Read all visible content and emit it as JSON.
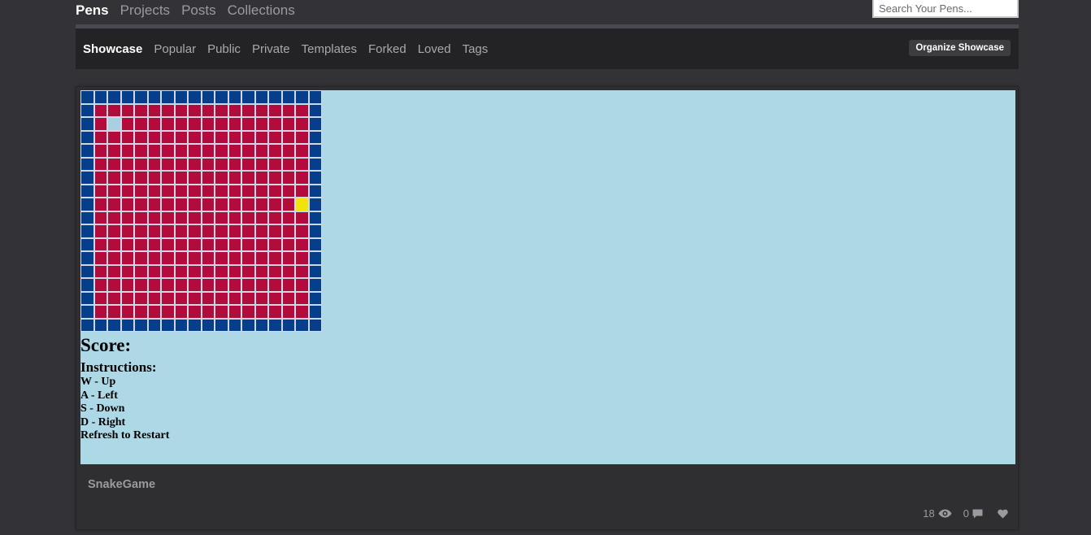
{
  "top_nav": {
    "items": [
      {
        "label": "Pens",
        "active": true
      },
      {
        "label": "Projects",
        "active": false
      },
      {
        "label": "Posts",
        "active": false
      },
      {
        "label": "Collections",
        "active": false
      }
    ]
  },
  "search": {
    "placeholder": "Search Your Pens..."
  },
  "sub_nav": {
    "items": [
      {
        "label": "Showcase",
        "active": true
      },
      {
        "label": "Popular",
        "active": false
      },
      {
        "label": "Public",
        "active": false
      },
      {
        "label": "Private",
        "active": false
      },
      {
        "label": "Templates",
        "active": false
      },
      {
        "label": "Forked",
        "active": false
      },
      {
        "label": "Loved",
        "active": false
      },
      {
        "label": "Tags",
        "active": false
      }
    ],
    "organize_label": "Organize Showcase"
  },
  "pen": {
    "title": "SnakeGame",
    "views": "18",
    "comments": "0",
    "preview": {
      "grid_size": 18,
      "snake_cell": [
        2,
        2
      ],
      "food_cell": [
        16,
        8
      ],
      "colors": {
        "wall": "#053e8a",
        "floor": "#b20b3c",
        "snake": "#a8d0e0",
        "food": "#f1e40a",
        "background": "#add8e6"
      },
      "score_label": "Score:",
      "instructions_title": "Instructions:",
      "instructions": [
        "W - Up",
        "A - Left",
        "S - Down",
        "D - Right",
        "Refresh to Restart"
      ]
    }
  }
}
